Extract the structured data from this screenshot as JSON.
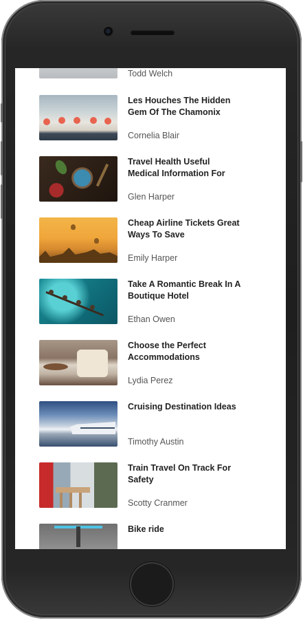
{
  "articles": [
    {
      "title": "",
      "author": "Todd Welch",
      "image": "snowy-landscape-photo"
    },
    {
      "title": "Les Houches The Hidden Gem Of The Chamonix",
      "author": "Cornelia Blair",
      "image": "beach-umbrellas-photo"
    },
    {
      "title": "Travel Health Useful Medical Information For",
      "author": "Glen Harper",
      "image": "smoothie-bowl-photo"
    },
    {
      "title": "Cheap Airline Tickets Great Ways To Save",
      "author": "Emily Harper",
      "image": "hot-air-balloons-photo"
    },
    {
      "title": "Take A Romantic Break In A Boutique Hotel",
      "author": "Ethan Owen",
      "image": "overwater-bungalows-photo"
    },
    {
      "title": "Choose the Perfect Accommodations",
      "author": "Lydia Perez",
      "image": "hotel-room-photo"
    },
    {
      "title": "Cruising Destination Ideas",
      "author": "Timothy Austin",
      "image": "cruise-ship-photo"
    },
    {
      "title": "Train Travel On Track For Safety",
      "author": "Scotty Cranmer",
      "image": "train-bridge-photo"
    },
    {
      "title": "Bike ride",
      "author": "",
      "image": "bicycle-handlebar-photo"
    }
  ]
}
